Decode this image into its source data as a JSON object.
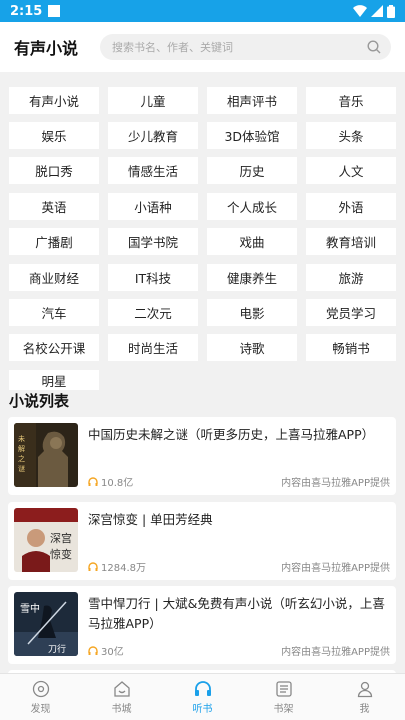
{
  "status": {
    "time": "2:15"
  },
  "header": {
    "title": "有声小说",
    "search_placeholder": "搜索书名、作者、关键词"
  },
  "categories": [
    "有声小说",
    "儿童",
    "相声评书",
    "音乐",
    "娱乐",
    "少儿教育",
    "3D体验馆",
    "头条",
    "脱口秀",
    "情感生活",
    "历史",
    "人文",
    "英语",
    "小语种",
    "个人成长",
    "外语",
    "广播剧",
    "国学书院",
    "戏曲",
    "教育培训",
    "商业财经",
    "IT科技",
    "健康养生",
    "旅游",
    "汽车",
    "二次元",
    "电影",
    "党员学习",
    "名校公开课",
    "时尚生活",
    "诗歌",
    "畅销书",
    "明星"
  ],
  "section_title": "小说列表",
  "books": [
    {
      "title": "中国历史未解之谜（听更多历史，上喜马拉雅APP）",
      "plays": "10.8亿",
      "provider": "内容由喜马拉雅APP提供",
      "cover_icon": "terracotta-warrior-cover"
    },
    {
      "title": "深宫惊变 | 单田芳经典",
      "plays": "1284.8万",
      "provider": "内容由喜马拉雅APP提供",
      "cover_icon": "storyteller-cover"
    },
    {
      "title": "雪中悍刀行 | 大斌&免费有声小说（听玄幻小说，上喜马拉雅APP）",
      "plays": "30亿",
      "provider": "内容由喜马拉雅APP提供",
      "cover_icon": "swordsman-cover"
    }
  ],
  "nav": [
    {
      "label": "发现",
      "icon": "compass-icon"
    },
    {
      "label": "书城",
      "icon": "bookstore-icon"
    },
    {
      "label": "听书",
      "icon": "headphones-icon"
    },
    {
      "label": "书架",
      "icon": "bookshelf-icon"
    },
    {
      "label": "我",
      "icon": "user-icon"
    }
  ],
  "colors": {
    "accent": "#1aa0ea",
    "status_bar": "#17a2e8",
    "play_icon": "#f5a623"
  }
}
